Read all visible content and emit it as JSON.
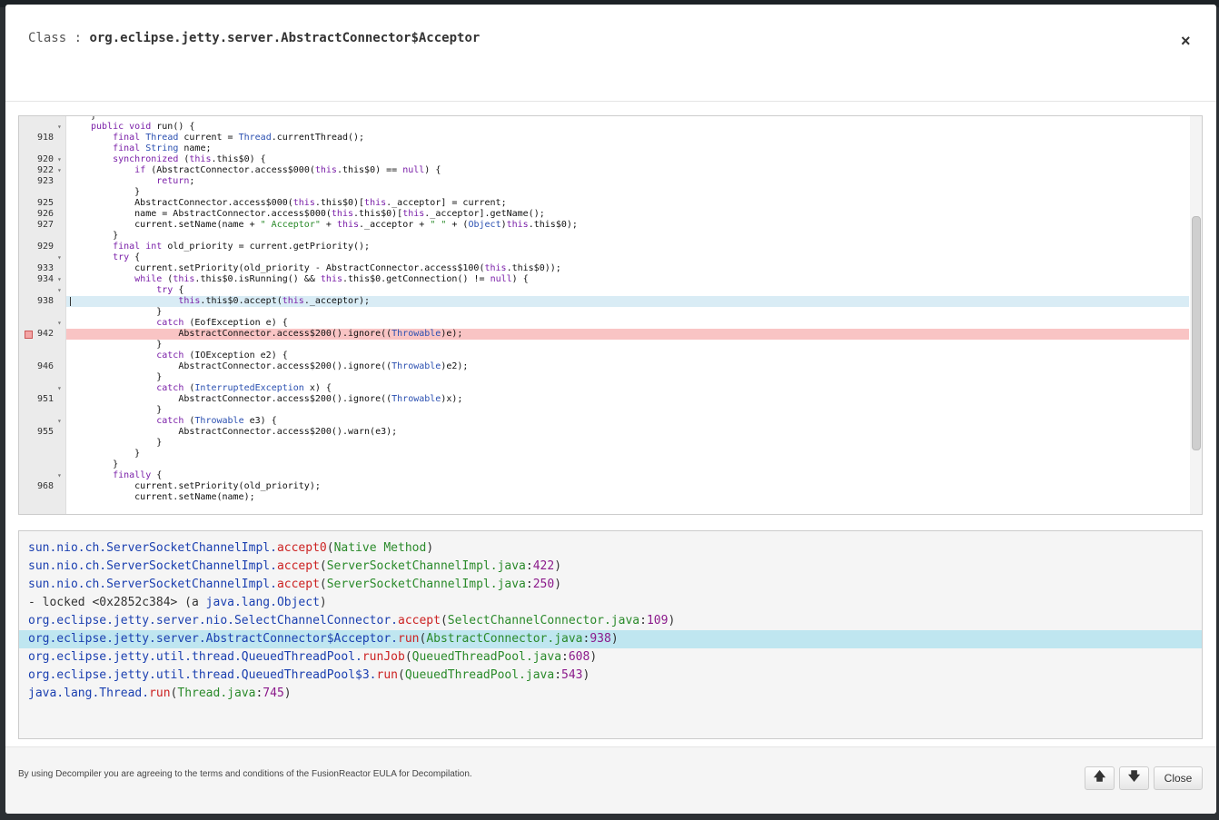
{
  "header": {
    "title_prefix": "Class : ",
    "class_name": "org.eclipse.jetty.server.AbstractConnector$Acceptor",
    "close_glyph": "×"
  },
  "code": {
    "lines": [
      {
        "n": "",
        "fold": "",
        "html": "}"
      },
      {
        "n": "",
        "fold": "▾",
        "html": "<span class='k'>public</span> <span class='k'>void</span> run() {"
      },
      {
        "n": "918",
        "fold": "",
        "html": "    <span class='k'>final</span> <span class='t'>Thread</span> current = <span class='t'>Thread</span>.currentThread();"
      },
      {
        "n": "",
        "fold": "",
        "html": "    <span class='k'>final</span> <span class='t'>String</span> name;"
      },
      {
        "n": "920",
        "fold": "▾",
        "html": "    <span class='k'>synchronized</span> (<span class='k'>this</span>.this$0) {"
      },
      {
        "n": "922",
        "fold": "▾",
        "html": "        <span class='k'>if</span> (AbstractConnector.access$000(<span class='k'>this</span>.this$0) == <span class='k'>null</span>) {"
      },
      {
        "n": "923",
        "fold": "",
        "html": "            <span class='k'>return</span>;"
      },
      {
        "n": "",
        "fold": "",
        "html": "        }"
      },
      {
        "n": "925",
        "fold": "",
        "html": "        AbstractConnector.access$000(<span class='k'>this</span>.this$0)[<span class='k'>this</span>._acceptor] = current;"
      },
      {
        "n": "926",
        "fold": "",
        "html": "        name = AbstractConnector.access$000(<span class='k'>this</span>.this$0)[<span class='k'>this</span>._acceptor].getName();"
      },
      {
        "n": "927",
        "fold": "",
        "html": "        current.setName(name + <span class='s'>\" Acceptor\"</span> + <span class='k'>this</span>._acceptor + <span class='s'>\" \"</span> + (<span class='t'>Object</span>)<span class='k'>this</span>.this$0);"
      },
      {
        "n": "",
        "fold": "",
        "html": "    }"
      },
      {
        "n": "929",
        "fold": "",
        "html": "    <span class='k'>final</span> <span class='k'>int</span> old_priority = current.getPriority();"
      },
      {
        "n": "",
        "fold": "▾",
        "html": "    <span class='k'>try</span> {"
      },
      {
        "n": "933",
        "fold": "",
        "html": "        current.setPriority(old_priority - AbstractConnector.access$100(<span class='k'>this</span>.this$0));"
      },
      {
        "n": "934",
        "fold": "▾",
        "html": "        <span class='k'>while</span> (<span class='k'>this</span>.this$0.isRunning() &amp;&amp; <span class='k'>this</span>.this$0.getConnection() != <span class='k'>null</span>) {"
      },
      {
        "n": "",
        "fold": "▾",
        "html": "            <span class='k'>try</span> {"
      },
      {
        "n": "938",
        "fold": "",
        "html": "                <span class='k'>this</span>.this$0.accept(<span class='k'>this</span>._acceptor);",
        "hl": "blue"
      },
      {
        "n": "",
        "fold": "",
        "html": "            }"
      },
      {
        "n": "",
        "fold": "▾",
        "html": "            <span class='k'>catch</span> (EofException e) {"
      },
      {
        "n": "942",
        "fold": "",
        "html": "                AbstractConnector.access$200().ignore((<span class='t'>Throwable</span>)e);",
        "hl": "red"
      },
      {
        "n": "",
        "fold": "",
        "html": "            }"
      },
      {
        "n": "",
        "fold": "",
        "html": "            <span class='k'>catch</span> (IOException e2) {"
      },
      {
        "n": "946",
        "fold": "",
        "html": "                AbstractConnector.access$200().ignore((<span class='t'>Throwable</span>)e2);"
      },
      {
        "n": "",
        "fold": "",
        "html": "            }"
      },
      {
        "n": "",
        "fold": "▾",
        "html": "            <span class='k'>catch</span> (<span class='t'>InterruptedException</span> x) {"
      },
      {
        "n": "951",
        "fold": "",
        "html": "                AbstractConnector.access$200().ignore((<span class='t'>Throwable</span>)x);"
      },
      {
        "n": "",
        "fold": "",
        "html": "            }"
      },
      {
        "n": "",
        "fold": "▾",
        "html": "            <span class='k'>catch</span> (<span class='t'>Throwable</span> e3) {"
      },
      {
        "n": "955",
        "fold": "",
        "html": "                AbstractConnector.access$200().warn(e3);"
      },
      {
        "n": "",
        "fold": "",
        "html": "            }"
      },
      {
        "n": "",
        "fold": "",
        "html": "        }"
      },
      {
        "n": "",
        "fold": "",
        "html": "    }"
      },
      {
        "n": "",
        "fold": "▾",
        "html": "    <span class='k'>finally</span> {"
      },
      {
        "n": "968",
        "fold": "",
        "html": "        current.setPriority(old_priority);"
      },
      {
        "n": "",
        "fold": "",
        "html": "        current.setName(name);"
      }
    ]
  },
  "stack": [
    {
      "cls": "sun.nio.ch.ServerSocketChannelImpl.",
      "mth": "accept0",
      "src": "Native Method",
      "num": ""
    },
    {
      "cls": "sun.nio.ch.ServerSocketChannelImpl.",
      "mth": "accept",
      "src": "ServerSocketChannelImpl.java",
      "num": "422"
    },
    {
      "cls": "sun.nio.ch.ServerSocketChannelImpl.",
      "mth": "accept",
      "src": "ServerSocketChannelImpl.java",
      "num": "250"
    },
    {
      "plain": "- locked <0x2852c384> (a ",
      "cls": "java.lang.Object",
      "tail": ")"
    },
    {
      "cls": "org.eclipse.jetty.server.nio.SelectChannelConnector.",
      "mth": "accept",
      "src": "SelectChannelConnector.java",
      "num": "109"
    },
    {
      "cls": "org.eclipse.jetty.server.AbstractConnector$Acceptor.",
      "mth": "run",
      "src": "AbstractConnector.java",
      "num": "938",
      "active": true
    },
    {
      "cls": "org.eclipse.jetty.util.thread.QueuedThreadPool.",
      "mth": "runJob",
      "src": "QueuedThreadPool.java",
      "num": "608"
    },
    {
      "cls": "org.eclipse.jetty.util.thread.QueuedThreadPool$3.",
      "mth": "run",
      "src": "QueuedThreadPool.java",
      "num": "543"
    },
    {
      "cls": "java.lang.Thread.",
      "mth": "run",
      "src": "Thread.java",
      "num": "745"
    }
  ],
  "footer": {
    "eula": "By using Decompiler you are agreeing to the terms and conditions of the FusionReactor EULA for Decompilation.",
    "up_glyph": "🡅",
    "down_glyph": "🡇",
    "close_label": "Close"
  },
  "icons": {
    "up": "arrow-up-icon",
    "down": "arrow-down-icon",
    "close": "close-icon",
    "breakpoint": "breakpoint-marker-icon"
  }
}
